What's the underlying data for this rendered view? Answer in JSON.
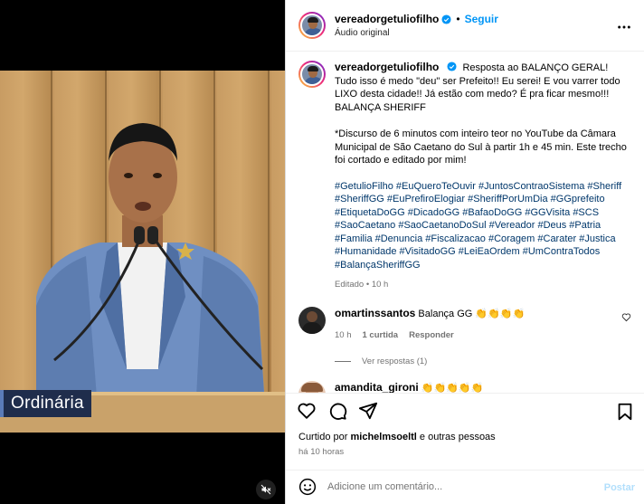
{
  "post": {
    "author": "vereadorgetuliofilho",
    "follow_label": "Seguir",
    "separator": "•",
    "audio_label": "Áudio original"
  },
  "video": {
    "lower_third": "Ordinária"
  },
  "caption": {
    "author": "vereadorgetuliofilho",
    "text1": "Resposta ao BALANÇO GERAL! Tudo isso é medo \"deu\" ser Prefeito!! Eu serei! E vou varrer todo LIXO desta cidade!! Já estão com medo? É pra ficar mesmo!!! BALANÇA SHERIFF",
    "text2": "*Discurso de 6 minutos com inteiro teor no YouTube da Câmara Municipal de São Caetano do Sul à partir 1h e 45 min. Este trecho foi cortado e editado por mim!",
    "hashtags": "#GetulioFilho #EuQueroTeOuvir #JuntosContraoSistema #Sheriff #SheriffGG #EuPrefiroElogiar #SheriffPorUmDia #GGprefeito #EtiquetaDoGG #DicadoGG #BafaoDoGG #GGVisita #SCS #SaoCaetano #SaoCaetanoDoSul #Vereador #Deus #Patria #Familia #Denuncia #Fiscalizacao #Coragem #Carater #Justica #Humanidade #VisitadoGG #LeiEaOrdem #UmContraTodos #BalançaSheriffGG",
    "meta": "Editado • 10 h"
  },
  "comments": [
    {
      "author": "omartinssantos",
      "text": "Balança GG 👏👏👏👏",
      "time": "10 h",
      "likes": "1 curtida",
      "reply": "Responder",
      "view_replies": "Ver respostas (1)"
    },
    {
      "author": "amandita_gironi",
      "text": "👏👏👏👏👏"
    }
  ],
  "likes": {
    "prefix": "Curtido por",
    "user": "michelmsoeltl",
    "suffix": "e outras pessoas"
  },
  "timestamp": "há 10 horas",
  "composer": {
    "placeholder": "Adicione um comentário...",
    "post_label": "Postar"
  },
  "colors": {
    "link": "#0095f6",
    "hashtag": "#00376b",
    "muted": "#737373"
  }
}
